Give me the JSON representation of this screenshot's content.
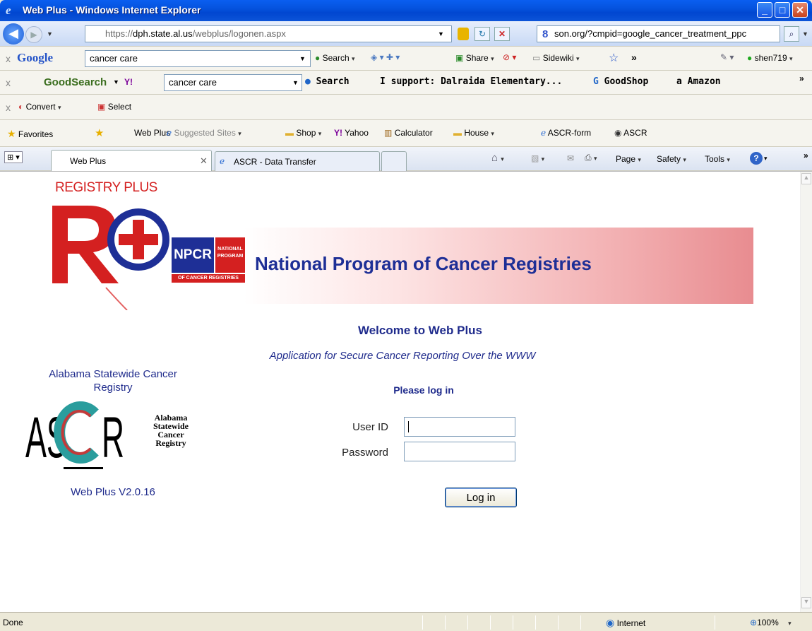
{
  "window": {
    "title": "Web Plus - Windows Internet Explorer"
  },
  "address": {
    "url_prefix": "https://",
    "url_host": "dph.state.al.us",
    "url_path": "/webplus/logonen.aspx",
    "search_text": "son.org/?cmpid=google_cancer_treatment_ppc"
  },
  "google_toolbar": {
    "brand": "Google",
    "query": "cancer care",
    "search_label": "Search",
    "share_label": "Share",
    "sidewiki_label": "Sidewiki",
    "overflow": "»",
    "user": "shen719"
  },
  "goodsearch_toolbar": {
    "brand": "GoodSearch",
    "query": "cancer care",
    "search_label": "Search",
    "support_text": "I support: Dalraida Elementary...",
    "goodshop_label": "GoodShop",
    "amazon_label": "Amazon",
    "overflow": "»"
  },
  "convert_toolbar": {
    "convert_label": "Convert",
    "select_label": "Select"
  },
  "favorites_bar": {
    "favorites_label": "Favorites",
    "items": [
      "Web Plus",
      "Suggested Sites",
      "Shop",
      "Yahoo",
      "Calculator",
      "House",
      "ASCR-form",
      "ASCR"
    ]
  },
  "tabs": [
    {
      "label": "Web Plus"
    },
    {
      "label": "ASCR - Data Transfer"
    }
  ],
  "command_bar": {
    "page": "Page",
    "safety": "Safety",
    "tools": "Tools",
    "overflow": "»"
  },
  "page": {
    "registry_plus": "REGISTRY PLUS",
    "npcr_title": "National Program of Cancer Registries",
    "npcr_logo_big": "NPCR",
    "npcr_logo_small1": "NATIONAL",
    "npcr_logo_small2": "PROGRAM",
    "npcr_logo_bottom": "OF CANCER REGISTRIES",
    "welcome": "Welcome to Web Plus",
    "subtitle": "Application for Secure Cancer Reporting Over the WWW",
    "please_login": "Please log in",
    "registry_name": "Alabama Statewide Cancer Registry",
    "ascr_logo": "ASCR",
    "ascr_side": [
      "Alabama",
      "Statewide",
      "Cancer",
      "Registry"
    ],
    "version": "Web Plus V2.0.16",
    "user_id_label": "User ID",
    "password_label": "Password",
    "login_button": "Log in"
  },
  "status": {
    "left": "Done",
    "zone": "Internet",
    "zoom": "100%"
  }
}
